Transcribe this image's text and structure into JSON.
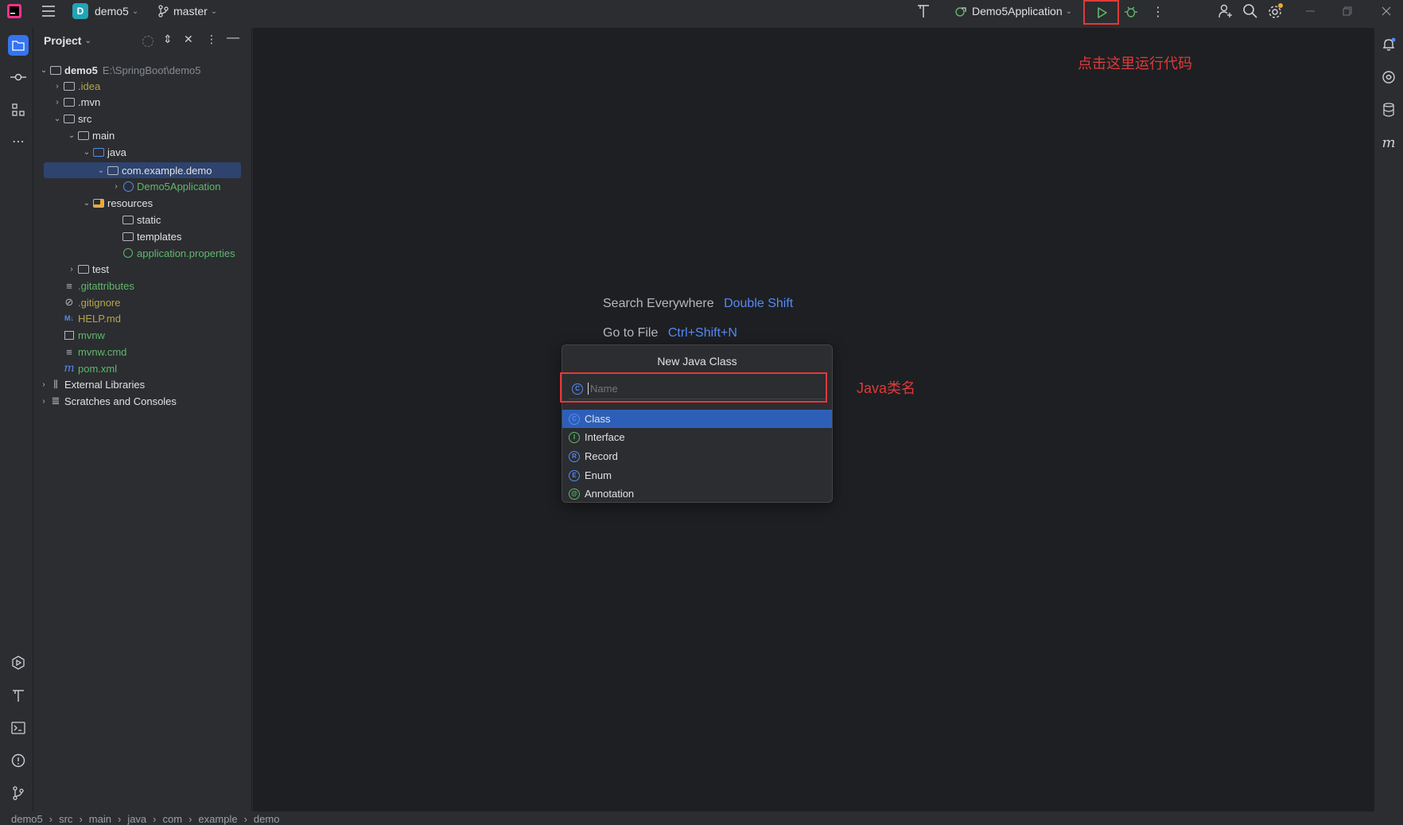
{
  "titlebar": {
    "project_badge": "D",
    "project_name": "demo5",
    "branch": "master",
    "run_config": "Demo5Application"
  },
  "project_panel": {
    "title": "Project",
    "tree": [
      {
        "label": "demo5",
        "hint": "E:\\SpringBoot\\demo5",
        "color": "#dfe1e5"
      },
      {
        "label": ".idea",
        "color": "#b5a64e"
      },
      {
        "label": ".mvn",
        "color": "#dfe1e5"
      },
      {
        "label": "src",
        "color": "#dfe1e5"
      },
      {
        "label": "main",
        "color": "#dfe1e5"
      },
      {
        "label": "java",
        "color": "#dfe1e5"
      },
      {
        "label": "com.example.demo",
        "color": "#dfe1e5"
      },
      {
        "label": "Demo5Application",
        "color": "#5fb86b"
      },
      {
        "label": "resources",
        "color": "#dfe1e5"
      },
      {
        "label": "static",
        "color": "#dfe1e5"
      },
      {
        "label": "templates",
        "color": "#dfe1e5"
      },
      {
        "label": "application.properties",
        "color": "#5fb86b"
      },
      {
        "label": "test",
        "color": "#dfe1e5"
      },
      {
        "label": ".gitattributes",
        "color": "#5fb86b"
      },
      {
        "label": ".gitignore",
        "color": "#b5a64e"
      },
      {
        "label": "HELP.md",
        "color": "#b5a64e"
      },
      {
        "label": "mvnw",
        "color": "#5fb86b"
      },
      {
        "label": "mvnw.cmd",
        "color": "#5fb86b"
      },
      {
        "label": "pom.xml",
        "color": "#5fb86b"
      },
      {
        "label": "External Libraries",
        "color": "#dfe1e5"
      },
      {
        "label": "Scratches and Consoles",
        "color": "#dfe1e5"
      }
    ]
  },
  "editor": {
    "hint1_label": "Search Everywhere",
    "hint1_shortcut": "Double Shift",
    "hint2_label": "Go to File",
    "hint2_shortcut": "Ctrl+Shift+N"
  },
  "dialog": {
    "title": "New Java Class",
    "placeholder": "Name",
    "kinds": [
      {
        "label": "Class",
        "letter": "C"
      },
      {
        "label": "Interface",
        "letter": "I"
      },
      {
        "label": "Record",
        "letter": "R"
      },
      {
        "label": "Enum",
        "letter": "E"
      },
      {
        "label": "Annotation",
        "letter": "@"
      }
    ]
  },
  "annotations": {
    "run_note": "点击这里运行代码",
    "name_note": "Java类名"
  },
  "statusbar": {
    "breadcrumb": [
      "demo5",
      "src",
      "main",
      "java",
      "com",
      "example",
      "demo"
    ]
  },
  "colors": {
    "accent_blue": "#548af7",
    "selection": "#2e436e",
    "annotation_red": "#e03a3a",
    "run_green": "#5fb86b"
  }
}
